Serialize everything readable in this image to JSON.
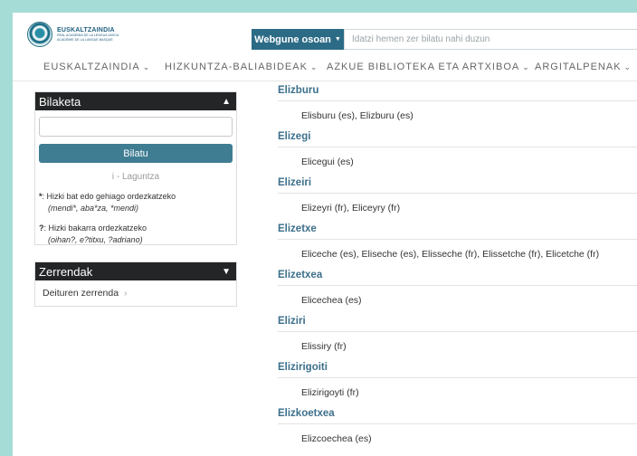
{
  "header": {
    "logo_name": "EUSKALTZAINDIA",
    "logo_sub_1": "REAL ACADEMIA DE LA LENGUA VASCA",
    "logo_sub_2": "ACADÉMIE DE LA LANGUE BASQUE",
    "search_scope": "Webgune osoan",
    "search_placeholder": "Idatzi hemen zer bilatu nahi duzun"
  },
  "nav": {
    "items": [
      "EUSKALTZAINDIA",
      "HIZKUNTZA-BALIABIDEAK",
      "AZKUE BIBLIOTEKA ETA ARTXIBOA",
      "ARGITALPENAK"
    ]
  },
  "sidebar": {
    "search": {
      "title": "Bilaketa",
      "button": "Bilatu",
      "help": "i - Laguntza",
      "hint1_key": "*",
      "hint1_text": ": Hizki bat edo gehiago ordezkatzeko",
      "hint1_examples": "(mendi*, aba*za, *mendi)",
      "hint2_key": "?",
      "hint2_text": ": Hizki bakarra ordezkatzeko",
      "hint2_examples": "(oihan?, e?titxu, ?adriano)"
    },
    "lists": {
      "title": "Zerrendak",
      "link": "Deituren zerrenda"
    }
  },
  "entries": [
    {
      "title": "Elizburu",
      "forms": "Elisburu (es), Elizburu (es)"
    },
    {
      "title": "Elizegi",
      "forms": "Elicegui (es)"
    },
    {
      "title": "Elizeiri",
      "forms": "Elizeyri (fr), Eliceyry (fr)"
    },
    {
      "title": "Elizetxe",
      "forms": "Eliceche (es), Eliseche (es), Elisseche (fr), Elissetche (fr), Elicetche (fr)"
    },
    {
      "title": "Elizetxea",
      "forms": "Elicechea (es)"
    },
    {
      "title": "Eliziri",
      "forms": "Elissiry (fr)"
    },
    {
      "title": "Elizirigoiti",
      "forms": "Elizirigoyti (fr)"
    },
    {
      "title": "Elizkoetxea",
      "forms": "Elizcoechea (es)"
    }
  ],
  "colors": {
    "frame": "#a6dcd6",
    "accent": "#3c6f8b",
    "button": "#3f7d93",
    "panel_head": "#242526"
  }
}
